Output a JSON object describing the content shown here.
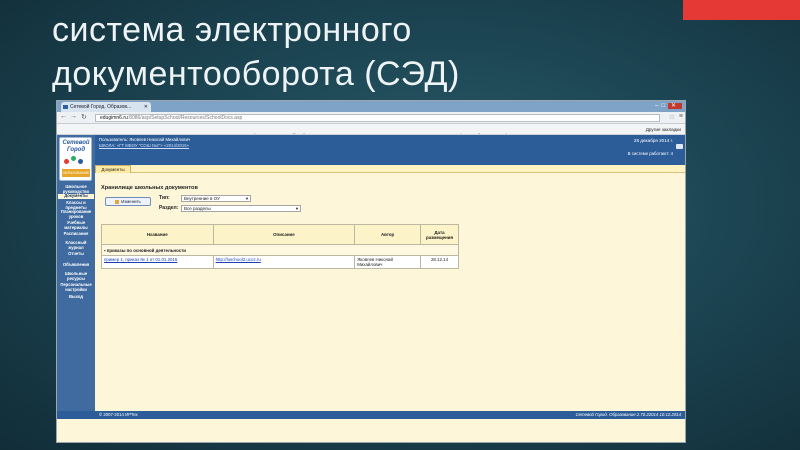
{
  "slide": {
    "title": "система электронного документооборота (СЭД)"
  },
  "colors": {
    "accent": "#e53935",
    "nav": "#3f6ba1",
    "header": "#2d5d99",
    "page": "#fdf6d8"
  },
  "browser": {
    "tab_title": "Сетевой Город. Образов...",
    "url_host": "edugimn6.ru",
    "url_path": ":8086/asp/SetupSchool/Resources/SchoolDocs.asp",
    "bookmarks": [
      {
        "label": "Сервисы",
        "color": "#5b7fbf"
      },
      {
        "label": "Яндекс",
        "color": "#e53935"
      },
      {
        "label": "Одноклассники",
        "color": "#f39c12"
      },
      {
        "label": "Радио",
        "color": "#7f8c8d"
      },
      {
        "label": "\"Ростелеком\"",
        "color": "#8e44ad"
      },
      {
        "label": "Сетевой Город",
        "color": "#2a5b9e"
      },
      {
        "label": "Дети@Mail.Ru",
        "color": "#3498db"
      },
      {
        "label": "Кинотеатр",
        "color": "#222222"
      },
      {
        "label": "Гос_услуги",
        "color": "#c0392b"
      },
      {
        "label": "Drom",
        "color": "#c0392b"
      },
      {
        "label": "Сарнал",
        "color": "#2c3e50"
      },
      {
        "label": "QR Coder",
        "color": "#27ae60"
      },
      {
        "label": "банк",
        "color": "#27ae60"
      },
      {
        "label": "мой",
        "color": "#16a085"
      }
    ],
    "bookmarks_more": "Другие закладки"
  },
  "site": {
    "logo_line1": "Сетевой",
    "logo_line2": "Город",
    "logo_sub": "ОБРАЗОВАНИЕ",
    "user_line": "Пользователь: Яковлев Николай Михайлович",
    "school_link": "ШКОЛА: «ГТ МБОУ \"СОШ №2\"» «2014/2015»",
    "date": "28 декабря 2014 г.",
    "users_online": "В системе работают: 4",
    "nav": [
      {
        "label": "Школьное руководство"
      },
      {
        "label": "Документы"
      },
      {
        "label": "Классы и предметы"
      },
      {
        "label": "Планирование уроков"
      },
      {
        "label": "Учебные материалы"
      },
      {
        "label": "Расписание"
      },
      {
        "label": "Классный журнал"
      },
      {
        "label": "Отчеты"
      },
      {
        "label": "Объявления"
      },
      {
        "label": "Школьные ресурсы"
      },
      {
        "label": "Персональные настройки"
      },
      {
        "label": "Выход"
      }
    ],
    "tab_label": "Документы",
    "section_title": "Хранилище школьных документов",
    "change_button": "Изменить",
    "type_label": "Тип:",
    "type_value": "Внутренние в ОУ",
    "section_label": "Раздел:",
    "section_value": "Все разделы",
    "table": {
      "headers": [
        "Название",
        "Описание",
        "Автор",
        "Дата размещения"
      ],
      "group": "приказы по основной деятельности",
      "rows": [
        {
          "name": "пример 1, приказ № 1 от 01.01.2015",
          "desc": "http://luschool2.ucoz.ru",
          "author": "Яковлев Николай Михайлович",
          "date": "28.12.14"
        }
      ]
    },
    "footer_left": "© 2007-2014 ИРТех",
    "footer_right": "Сетевой Город. Образование 2.70.22014      10.12.2014"
  }
}
